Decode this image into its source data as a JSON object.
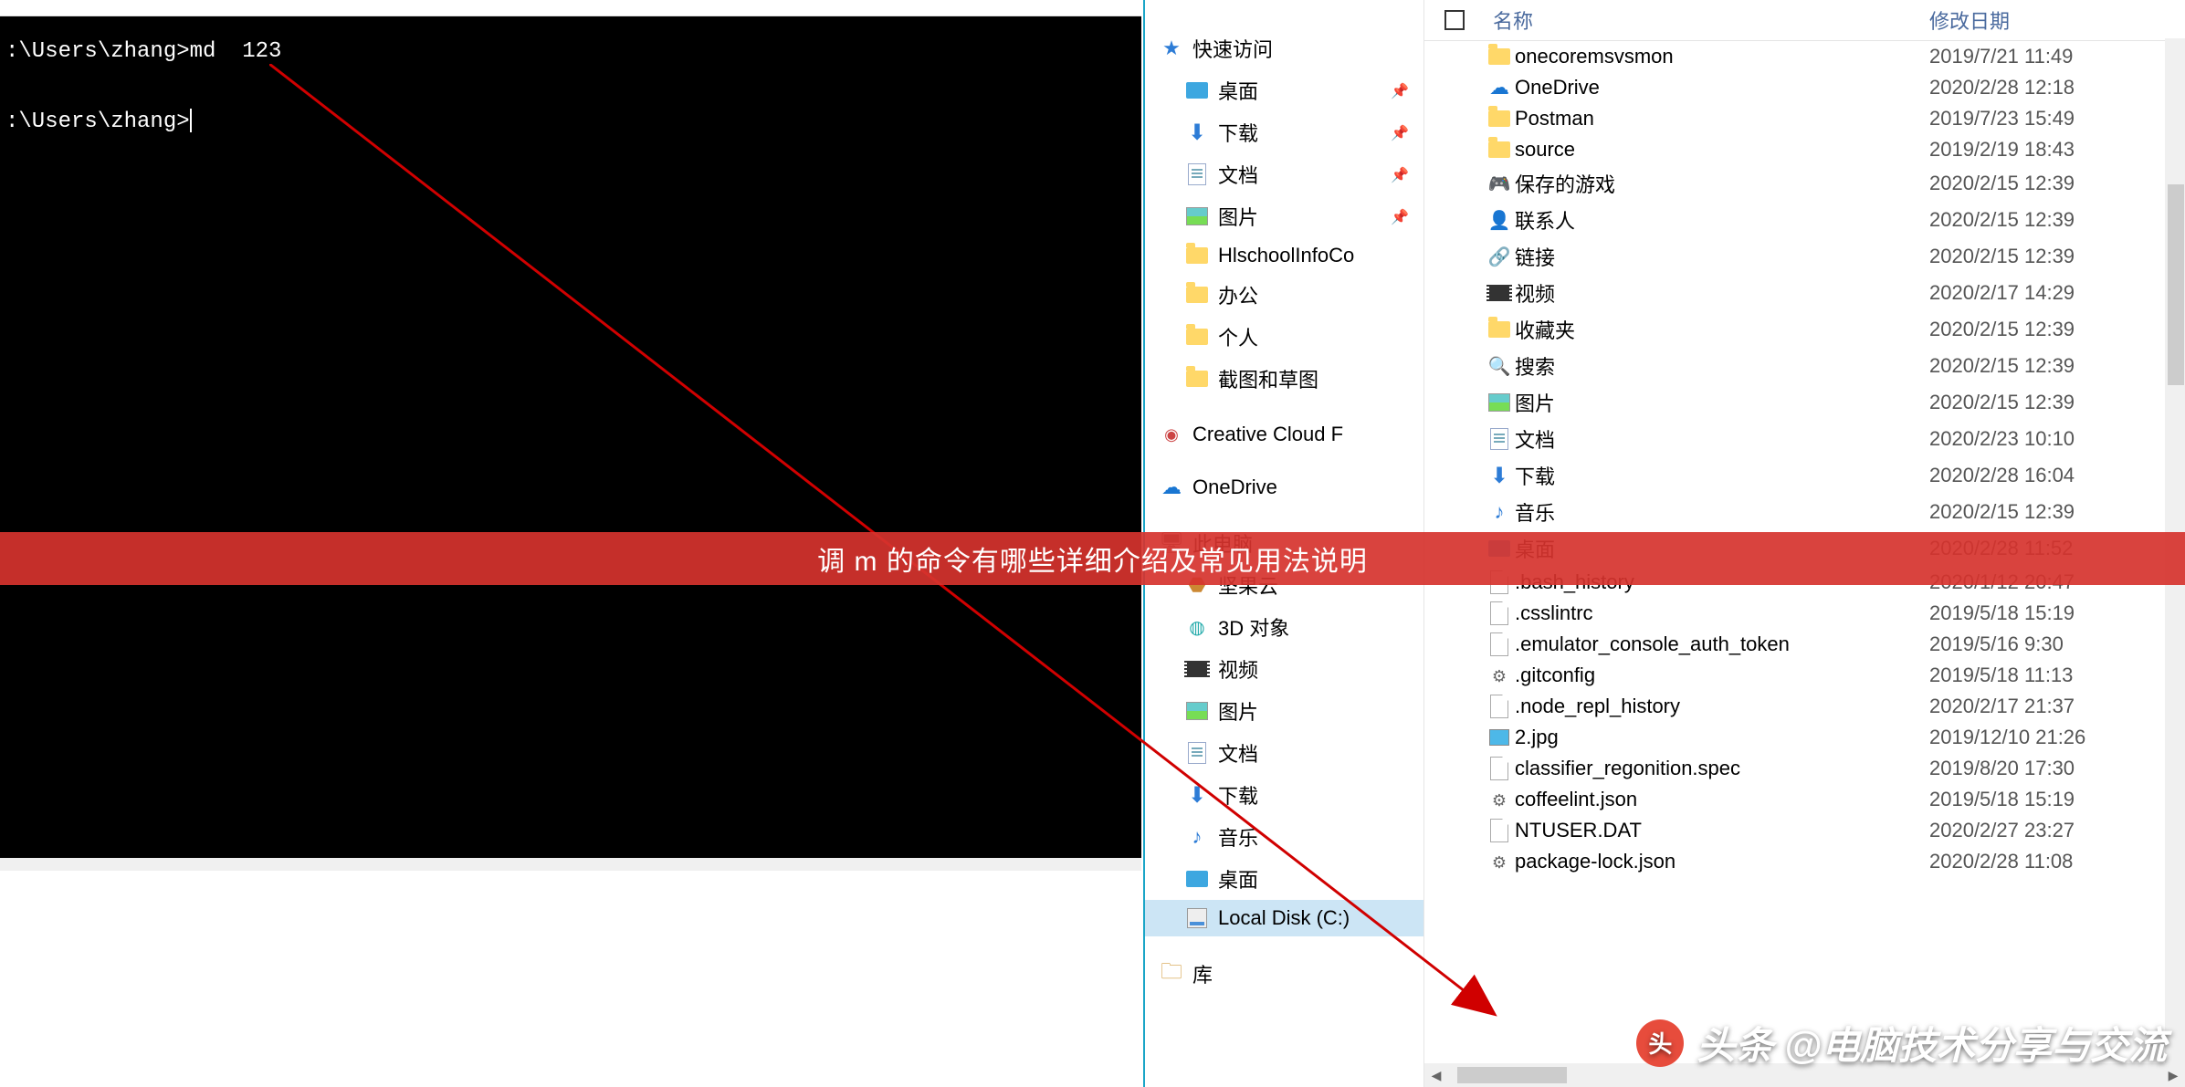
{
  "banner_text": "调 m 的命令有哪些详细介绍及常见用法说明",
  "watermark": {
    "prefix": "头条",
    "author": "@电脑技术分享与交流"
  },
  "cmd": {
    "line1": ":\\Users\\zhang>md  123",
    "line2": ":\\Users\\zhang>"
  },
  "nav_tree": [
    {
      "label": "快速访问",
      "icon": "star",
      "indent": 0
    },
    {
      "label": "桌面",
      "icon": "monitor",
      "indent": 1,
      "pinned": true
    },
    {
      "label": "下载",
      "icon": "down",
      "indent": 1,
      "pinned": true
    },
    {
      "label": "文档",
      "icon": "doc",
      "indent": 1,
      "pinned": true
    },
    {
      "label": "图片",
      "icon": "pic",
      "indent": 1,
      "pinned": true
    },
    {
      "label": "HlschoolInfoCo",
      "icon": "folder",
      "indent": 1
    },
    {
      "label": "办公",
      "icon": "folder",
      "indent": 1
    },
    {
      "label": "个人",
      "icon": "folder",
      "indent": 1
    },
    {
      "label": "截图和草图",
      "icon": "folder",
      "indent": 1
    },
    {
      "label": "Creative Cloud F",
      "icon": "cc",
      "indent": 0,
      "gap": true
    },
    {
      "label": "OneDrive",
      "icon": "cloud",
      "indent": 0,
      "gap": true
    },
    {
      "label": "此电脑",
      "icon": "pc",
      "indent": 0,
      "gap": true
    },
    {
      "label": "坚果云",
      "icon": "nut",
      "indent": 1
    },
    {
      "label": "3D 对象",
      "icon": "3d",
      "indent": 1
    },
    {
      "label": "视频",
      "icon": "video",
      "indent": 1
    },
    {
      "label": "图片",
      "icon": "pic",
      "indent": 1
    },
    {
      "label": "文档",
      "icon": "doc",
      "indent": 1
    },
    {
      "label": "下载",
      "icon": "down",
      "indent": 1
    },
    {
      "label": "音乐",
      "icon": "music",
      "indent": 1
    },
    {
      "label": "桌面",
      "icon": "monitor",
      "indent": 1
    },
    {
      "label": "Local Disk (C:)",
      "icon": "disk",
      "indent": 1,
      "selected": true
    },
    {
      "label": "库",
      "icon": "lib",
      "indent": 0,
      "gap": true
    }
  ],
  "file_header": {
    "name": "名称",
    "date": "修改日期"
  },
  "files": [
    {
      "name": "onecoremsvsmon",
      "date": "2019/7/21 11:49",
      "icon": "folder"
    },
    {
      "name": "OneDrive",
      "date": "2020/2/28 12:18",
      "icon": "cloud"
    },
    {
      "name": "Postman",
      "date": "2019/7/23 15:49",
      "icon": "folder"
    },
    {
      "name": "source",
      "date": "2019/2/19 18:43",
      "icon": "folder"
    },
    {
      "name": "保存的游戏",
      "date": "2020/2/15 12:39",
      "icon": "game"
    },
    {
      "name": "联系人",
      "date": "2020/2/15 12:39",
      "icon": "contacts"
    },
    {
      "name": "链接",
      "date": "2020/2/15 12:39",
      "icon": "link"
    },
    {
      "name": "视频",
      "date": "2020/2/17 14:29",
      "icon": "video"
    },
    {
      "name": "收藏夹",
      "date": "2020/2/15 12:39",
      "icon": "folder"
    },
    {
      "name": "搜索",
      "date": "2020/2/15 12:39",
      "icon": "search"
    },
    {
      "name": "图片",
      "date": "2020/2/15 12:39",
      "icon": "pic"
    },
    {
      "name": "文档",
      "date": "2020/2/23 10:10",
      "icon": "doc"
    },
    {
      "name": "下载",
      "date": "2020/2/28 16:04",
      "icon": "down"
    },
    {
      "name": "音乐",
      "date": "2020/2/15 12:39",
      "icon": "music"
    },
    {
      "name": "桌面",
      "date": "2020/2/28 11:52",
      "icon": "monitor"
    },
    {
      "name": ".bash_history",
      "date": "2020/1/12 20:47",
      "icon": "file"
    },
    {
      "name": ".csslintrc",
      "date": "2019/5/18 15:19",
      "icon": "file"
    },
    {
      "name": ".emulator_console_auth_token",
      "date": "2019/5/16 9:30",
      "icon": "file"
    },
    {
      "name": ".gitconfig",
      "date": "2019/5/18 11:13",
      "icon": "json"
    },
    {
      "name": ".node_repl_history",
      "date": "2020/2/17 21:37",
      "icon": "file"
    },
    {
      "name": "2.jpg",
      "date": "2019/12/10 21:26",
      "icon": "img"
    },
    {
      "name": "classifier_regonition.spec",
      "date": "2019/8/20 17:30",
      "icon": "file"
    },
    {
      "name": "coffeelint.json",
      "date": "2019/5/18 15:19",
      "icon": "json"
    },
    {
      "name": "NTUSER.DAT",
      "date": "2020/2/27 23:27",
      "icon": "file"
    },
    {
      "name": "package-lock.json",
      "date": "2020/2/28 11:08",
      "icon": "json"
    }
  ]
}
